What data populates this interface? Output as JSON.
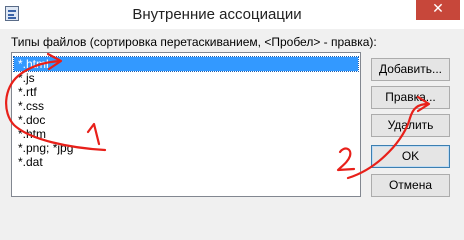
{
  "window": {
    "title": "Внутренние ассоциации",
    "close_glyph": "✕",
    "app_icon": "app-icon"
  },
  "hint": "Типы файлов (сортировка перетаскиванием, <Пробел> - правка):",
  "file_types": [
    "*.html",
    "*.js",
    "*.rtf",
    "*.css",
    "*.doc",
    "*.htm",
    "*.png; *jpg",
    "*.dat"
  ],
  "selected_index": 0,
  "buttons": {
    "add": "Добавить...",
    "edit": "Правка...",
    "delete": "Удалить",
    "ok": "OK",
    "cancel": "Отмена"
  },
  "annotations": {
    "color": "#e8201a",
    "label_1": "1",
    "label_2": "2"
  },
  "colors": {
    "selection": "#3399ff",
    "close_button": "#c7473a"
  }
}
